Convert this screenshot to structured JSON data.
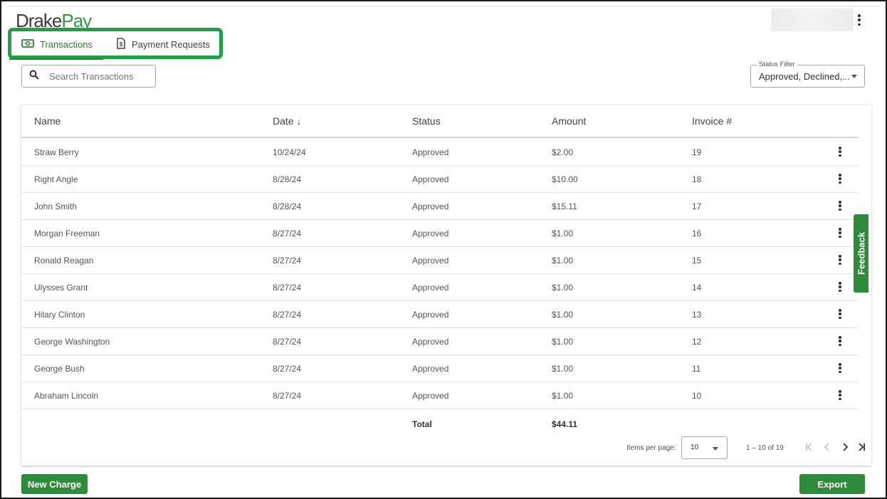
{
  "brand": {
    "drake": "Drake",
    "pay": "Pay"
  },
  "tabs": [
    {
      "label": "Transactions",
      "icon": "cash-icon",
      "active": true
    },
    {
      "label": "Payment Requests",
      "icon": "invoice-dollar-icon",
      "active": false
    }
  ],
  "search": {
    "placeholder": "Search Transactions",
    "value": ""
  },
  "status_filter": {
    "label": "Status Filter",
    "value": "Approved, Declined,..."
  },
  "table": {
    "headers": {
      "name": "Name",
      "date": "Date",
      "date_sort": "↓",
      "status": "Status",
      "amount": "Amount",
      "invoice": "Invoice #"
    },
    "rows": [
      {
        "name": "Straw Berry",
        "date": "10/24/24",
        "status": "Approved",
        "amount": "$2.00",
        "invoice": "19"
      },
      {
        "name": "Right Angle",
        "date": "8/28/24",
        "status": "Approved",
        "amount": "$10.00",
        "invoice": "18"
      },
      {
        "name": "John Smith",
        "date": "8/28/24",
        "status": "Approved",
        "amount": "$15.11",
        "invoice": "17"
      },
      {
        "name": "Morgan Freeman",
        "date": "8/27/24",
        "status": "Approved",
        "amount": "$1.00",
        "invoice": "16"
      },
      {
        "name": "Ronald Reagan",
        "date": "8/27/24",
        "status": "Approved",
        "amount": "$1.00",
        "invoice": "15"
      },
      {
        "name": "Ulysses Grant",
        "date": "8/27/24",
        "status": "Approved",
        "amount": "$1.00",
        "invoice": "14"
      },
      {
        "name": "Hilary Clinton",
        "date": "8/27/24",
        "status": "Approved",
        "amount": "$1.00",
        "invoice": "13"
      },
      {
        "name": "George Washington",
        "date": "8/27/24",
        "status": "Approved",
        "amount": "$1.00",
        "invoice": "12"
      },
      {
        "name": "George Bush",
        "date": "8/27/24",
        "status": "Approved",
        "amount": "$1.00",
        "invoice": "11"
      },
      {
        "name": "Abraham Lincoln",
        "date": "8/27/24",
        "status": "Approved",
        "amount": "$1.00",
        "invoice": "10"
      }
    ],
    "total_label": "Total",
    "total_value": "$44.11"
  },
  "pagination": {
    "items_per_page_label": "Items per page:",
    "items_per_page": "10",
    "range": "1 – 10 of 19"
  },
  "feedback_label": "Feedback",
  "buttons": {
    "new_charge": "New Charge",
    "export": "Export"
  },
  "colors": {
    "brand_green": "#2e8b3a",
    "highlight_green": "#1da343",
    "logo_green": "#2e9a3e"
  }
}
